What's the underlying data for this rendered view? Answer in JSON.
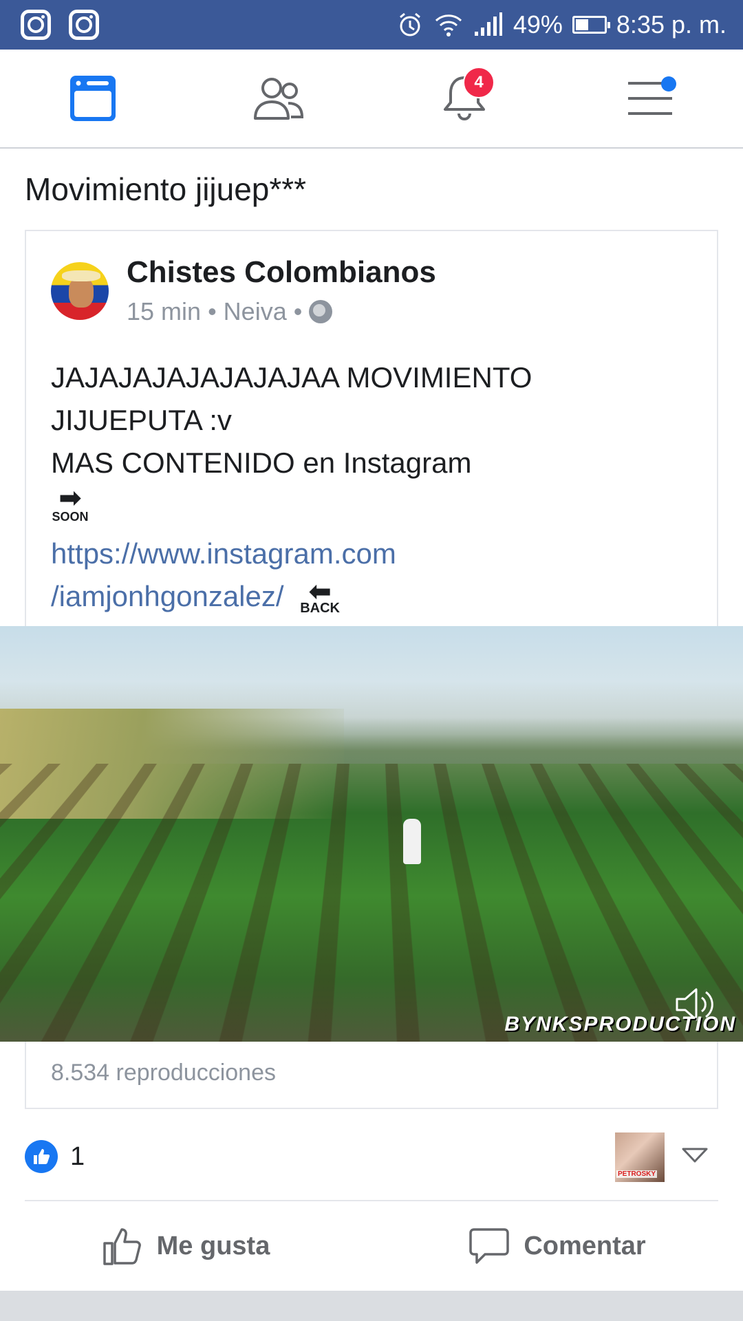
{
  "status_bar": {
    "battery": "49%",
    "time": "8:35 p. m.",
    "left_icons": [
      "instagram-icon",
      "instagram-icon"
    ],
    "right_icons": [
      "alarm-icon",
      "wifi-icon",
      "signal-icon",
      "battery-icon"
    ]
  },
  "nav": {
    "items": [
      "feed",
      "friends",
      "notifications",
      "menu"
    ],
    "notifications_badge": "4",
    "active_color": "#1877f2"
  },
  "post": {
    "caption": "Movimiento jijuep***",
    "shared": {
      "author": "Chistes Colombianos",
      "time": "15 min",
      "location": "Neiva",
      "separator": "•",
      "text_line1": "JAJAJAJAJAJAJAJAA MOVIMIENTO",
      "text_line2": "JIJUEPUTA :v",
      "text_line3": "MAS CONTENIDO en Instagram",
      "soon_label": "SOON",
      "link_line1": "https://www.instagram.com",
      "link_line2": "/iamjonhgonzalez/",
      "back_label": "BACK",
      "video_watermark": "BYNKSPRODUCTION",
      "views": "8.534 reproducciones"
    },
    "like_count": "1",
    "reactor_avatar_text": "PETROSKY",
    "actions": {
      "like": "Me gusta",
      "comment": "Comentar"
    }
  }
}
